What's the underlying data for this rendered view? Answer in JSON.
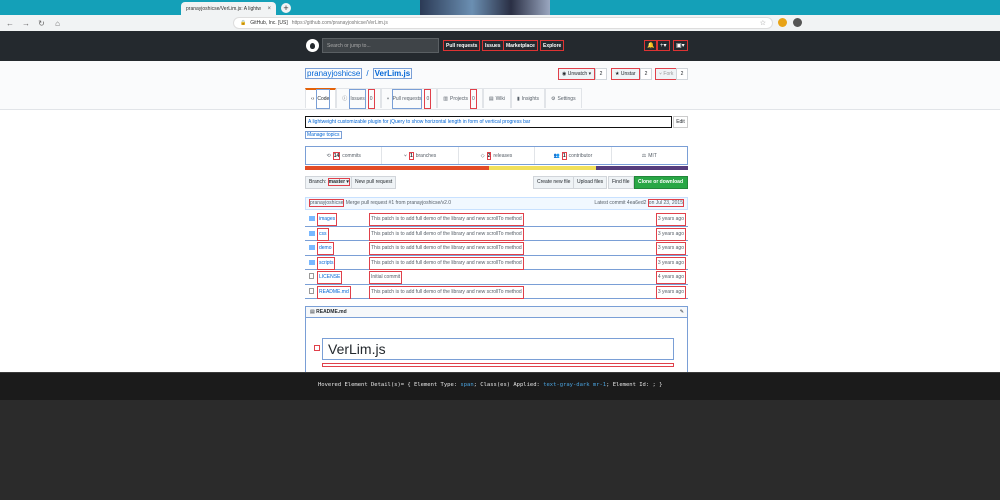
{
  "browser": {
    "tab_title": "pranayjoshicse/VerLim.js: A lightw",
    "tab_close": "×",
    "new_tab": "+",
    "nav": {
      "back": "←",
      "forward": "→",
      "reload": "↻",
      "home": "⌂"
    },
    "address": {
      "lock": "🔒",
      "org": "GitHub, Inc. [US]",
      "url": "https://github.com/pranayjoshicse/VerLim.js"
    },
    "star": "☆"
  },
  "gh_header": {
    "search_placeholder": "Search or jump to...",
    "nav": [
      "Pull requests",
      "Issues",
      "Marketplace",
      "Explore"
    ],
    "bell": "🔔",
    "plus": "+▾",
    "avatar": "▣▾"
  },
  "repo": {
    "owner": "pranayjoshicse",
    "separator": "/",
    "name": "VerLim.js",
    "unwatch_label": "◉ Unwatch ▾",
    "unwatch_count": "2",
    "star_label": "★ Unstar",
    "star_count": "2",
    "fork_label": "⑂ Fork",
    "fork_count": "2"
  },
  "reponav": [
    {
      "icon": "‹›",
      "label": "Code",
      "count": ""
    },
    {
      "icon": "ⓘ",
      "label": "Issues",
      "count": "0"
    },
    {
      "icon": "⑂",
      "label": "Pull requests",
      "count": "0"
    },
    {
      "icon": "▥",
      "label": "Projects",
      "count": "0"
    },
    {
      "icon": "▤",
      "label": "Wiki",
      "count": ""
    },
    {
      "icon": "▮",
      "label": "Insights",
      "count": ""
    },
    {
      "icon": "⚙",
      "label": "Settings",
      "count": ""
    }
  ],
  "description": "A lightweight customizable plugin for jQuery to show horizontal length in form of vertical progress bar",
  "edit_label": "Edit",
  "manage_topics": "Manage topics",
  "summary": [
    {
      "icon": "⟲",
      "num": "14",
      "label": "commits"
    },
    {
      "icon": "⑂",
      "num": "1",
      "label": "branches"
    },
    {
      "icon": "◇",
      "num": "2",
      "label": "releases"
    },
    {
      "icon": "👥",
      "num": "1",
      "label": "contributor"
    },
    {
      "icon": "⚖",
      "num": "",
      "label": "MIT"
    }
  ],
  "language_colors": [
    "#e34c26",
    "#f1e05a",
    "#563d7c"
  ],
  "language_shares": [
    0.48,
    0.28,
    0.24
  ],
  "filebar": {
    "branch_label": "Branch:",
    "branch_value": "master ▾",
    "new_pr": "New pull request",
    "create_file": "Create new file",
    "upload_files": "Upload files",
    "find_file": "Find file",
    "clone": "Clone or download ▾"
  },
  "commit": {
    "author": "pranayjoshicse",
    "message": "Merge pull request #1 from pranayjoshicse/v2.0",
    "latest": "Latest commit 4ea6ed2",
    "date": "on Jul 23, 2015"
  },
  "files": [
    {
      "type": "dir",
      "name": "images",
      "message": "This patch is to add full demo of the library and new scrollTo method",
      "age": "3 years ago"
    },
    {
      "type": "dir",
      "name": "css",
      "message": "This patch is to add full demo of the library and new scrollTo method",
      "age": "3 years ago"
    },
    {
      "type": "dir",
      "name": "demo",
      "message": "This patch is to add full demo of the library and new scrollTo method",
      "age": "3 years ago"
    },
    {
      "type": "dir",
      "name": "scripts",
      "message": "This patch is to add full demo of the library and new scrollTo method",
      "age": "3 years ago"
    },
    {
      "type": "file",
      "name": "LICENSE",
      "message": "Initial commit",
      "age": "4 years ago"
    },
    {
      "type": "file",
      "name": "README.md",
      "message": "This patch is to add full demo of the library and new scrollTo method",
      "age": "3 years ago"
    }
  ],
  "readme": {
    "icon": "▤",
    "filename": "README.md",
    "edit_icon": "✎",
    "heading": "VerLim.js"
  },
  "inspector": {
    "prefix": "Hovered Element Detail(s)= { Element Type: ",
    "type": "span",
    "mid": "; Class(es) Applied: ",
    "classes": "text-gray-dark mr-1",
    "suffix": "; Element Id: ; }"
  },
  "colors": {
    "accent_blue": "#0366d6",
    "clone_green": "#28a745",
    "header_dark": "#24292e",
    "highlight_red": "#e0404a"
  }
}
